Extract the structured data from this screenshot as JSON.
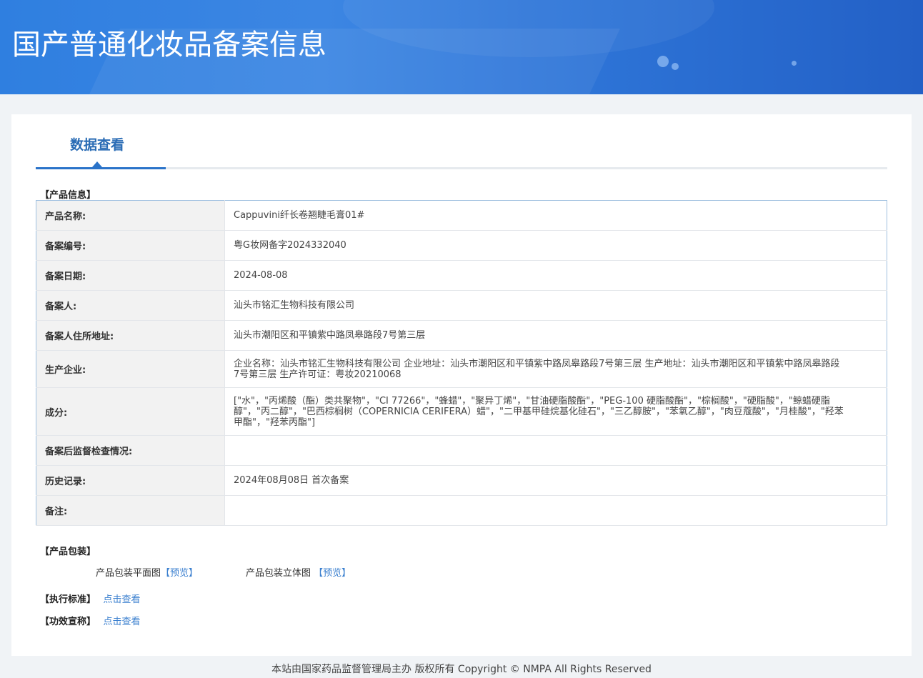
{
  "banner": {
    "title": "国产普通化妆品备案信息"
  },
  "tabs": {
    "active_label": "数据查看"
  },
  "sections": {
    "product_info": "【产品信息】",
    "packaging": "【产品包装】",
    "standard": "【执行标准】",
    "efficacy": "【功效宣称】"
  },
  "product": {
    "rows": [
      {
        "label": "产品名称:",
        "value": "Cappuvini纤长卷翘睫毛膏01#"
      },
      {
        "label": "备案编号:",
        "value": "粤G妆网备字2024332040"
      },
      {
        "label": "备案日期:",
        "value": "2024-08-08"
      },
      {
        "label": "备案人:",
        "value": "汕头市铭汇生物科技有限公司"
      },
      {
        "label": "备案人住所地址:",
        "value": "汕头市潮阳区和平镇紫中路凤皋路段7号第三层"
      },
      {
        "label": "生产企业:",
        "value": "企业名称：汕头市铭汇生物科技有限公司 企业地址：汕头市潮阳区和平镇紫中路凤皋路段7号第三层 生产地址：汕头市潮阳区和平镇紫中路凤皋路段7号第三层 生产许可证：粤妆20210068"
      },
      {
        "label": "成分:",
        "value": "[\"水\"，\"丙烯酸（酯）类共聚物\"，\"CI 77266\"，\"蜂蜡\"，\"聚异丁烯\"，\"甘油硬脂酸酯\"，\"PEG-100 硬脂酸酯\"，\"棕榈酸\"，\"硬脂酸\"，\"鲸蜡硬脂醇\"，\"丙二醇\"，\"巴西棕榈树（COPERNICIA CERIFERA）蜡\"，\"二甲基甲硅烷基化硅石\"，\"三乙醇胺\"，\"苯氧乙醇\"，\"肉豆蔻酸\"，\"月桂酸\"，\"羟苯甲酯\"，\"羟苯丙酯\"]"
      },
      {
        "label": "备案后监督检查情况:",
        "value": ""
      },
      {
        "label": "历史记录:",
        "value": "2024年08月08日 首次备案"
      },
      {
        "label": "备注:",
        "value": ""
      }
    ]
  },
  "packaging": {
    "flat_label": "产品包装平面图",
    "flat_link": "【预览】",
    "solid_label": "产品包装立体图",
    "solid_link": "【预览】"
  },
  "links": {
    "standard_link": "点击查看",
    "efficacy_link": "点击查看"
  },
  "footer": {
    "text": "本站由国家药品监督管理局主办 版权所有 Copyright © NMPA All Rights Reserved"
  }
}
